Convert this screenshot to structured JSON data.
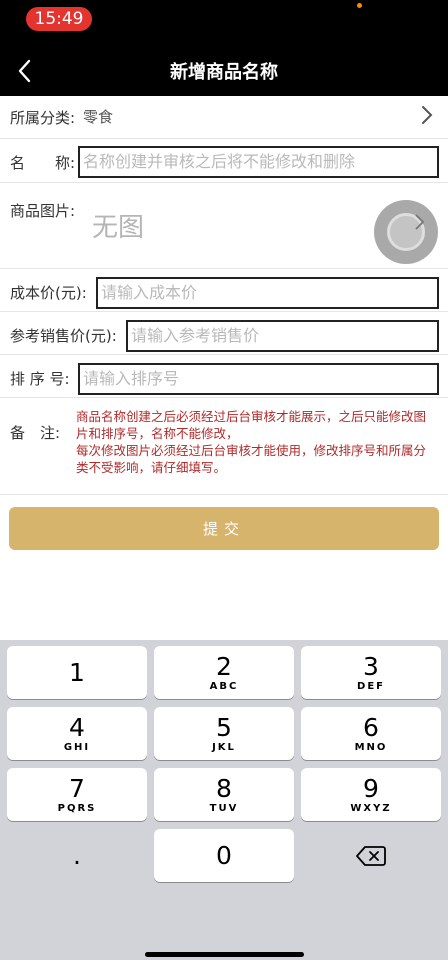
{
  "status_bar": {
    "time": "15:49"
  },
  "nav": {
    "title": "新增商品名称"
  },
  "form": {
    "category": {
      "label": "所属分类:",
      "value": "零食"
    },
    "name": {
      "label": "名　　称:",
      "placeholder": "名称创建并审核之后将不能修改和删除"
    },
    "image": {
      "label": "商品图片:",
      "empty_text": "无图"
    },
    "cost_price": {
      "label": "成本价(元):",
      "placeholder": "请输入成本价"
    },
    "ref_price": {
      "label": "参考销售价(元):",
      "placeholder": "请输入参考销售价"
    },
    "sort": {
      "label": "排 序 号:",
      "placeholder": "请输入排序号"
    },
    "remark": {
      "label": "备　注:",
      "text": "商品名称创建之后必须经过后台审核才能展示，之后只能修改图片和排序号，名称不能修改，\n每次修改图片必须经过后台审核才能使用，修改排序号和所属分类不受影响，请仔细填写。"
    },
    "submit_label": "提交"
  },
  "keypad": {
    "keys": [
      {
        "digit": "1",
        "letters": ""
      },
      {
        "digit": "2",
        "letters": "ABC"
      },
      {
        "digit": "3",
        "letters": "DEF"
      },
      {
        "digit": "4",
        "letters": "GHI"
      },
      {
        "digit": "5",
        "letters": "JKL"
      },
      {
        "digit": "6",
        "letters": "MNO"
      },
      {
        "digit": "7",
        "letters": "PQRS"
      },
      {
        "digit": "8",
        "letters": "TUV"
      },
      {
        "digit": "9",
        "letters": "WXYZ"
      },
      {
        "digit": ".",
        "letters": ""
      },
      {
        "digit": "0",
        "letters": ""
      }
    ],
    "delete_icon": "backspace-icon"
  },
  "colors": {
    "accent": "#d6b46b",
    "warning_text": "#b02a2a",
    "time_pill": "#e3342f"
  }
}
